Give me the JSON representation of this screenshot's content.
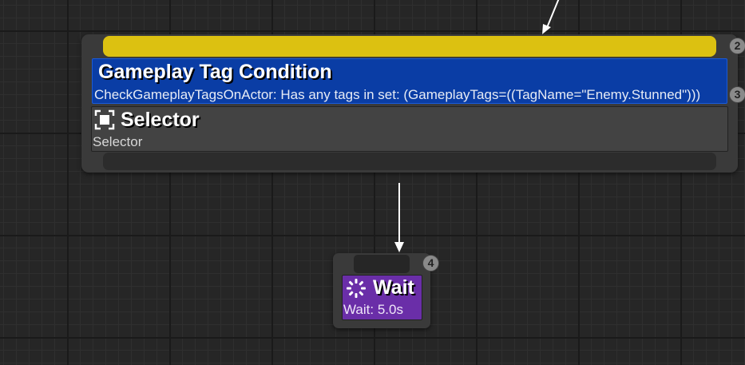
{
  "colors": {
    "graph_background": "#262626",
    "node_frame": "#3a3a3a",
    "input_pin": "#dcc111",
    "decorator_blue": "#0a3da5",
    "composite_gray": "#434343",
    "task_purple": "#6a2ea8",
    "wire": "#ffffff"
  },
  "selector_node": {
    "execution_order": "2",
    "icon": "selector-icon",
    "title": "Selector",
    "description": "Selector",
    "decorator": {
      "execution_order": "3",
      "title": "Gameplay Tag Condition",
      "description": "CheckGameplayTagsOnActor: Has any tags in set: (GameplayTags=((TagName=\"Enemy.Stunned\")))"
    }
  },
  "wait_node": {
    "execution_order": "4",
    "icon": "wait-icon",
    "title": "Wait",
    "description": "Wait: 5.0s"
  }
}
